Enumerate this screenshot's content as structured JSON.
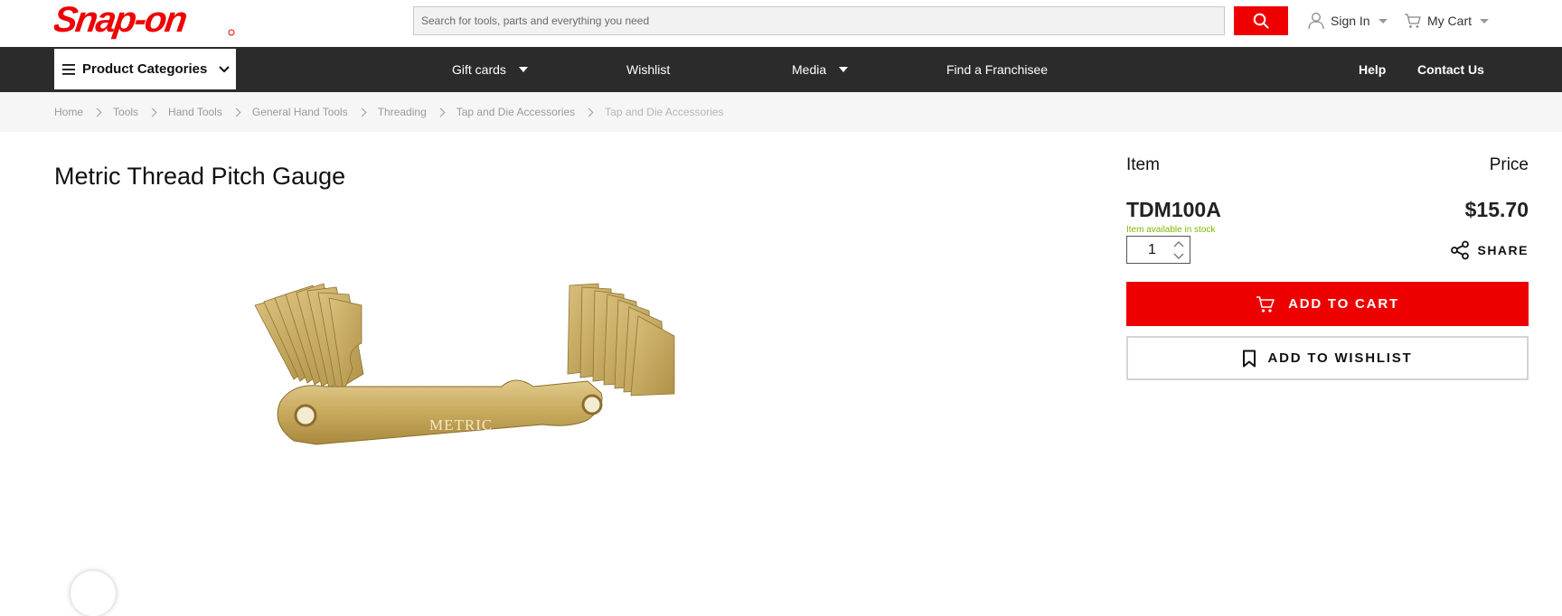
{
  "header": {
    "logo_alt": "Snap-on",
    "search_placeholder": "Search for tools, parts and everything you need",
    "sign_in": "Sign In",
    "cart": "My Cart"
  },
  "nav": {
    "categories": "Product Categories",
    "gift_cards": "Gift cards",
    "wishlist": "Wishlist",
    "media": "Media",
    "franchisee": "Find a Franchisee",
    "help": "Help",
    "contact": "Contact Us"
  },
  "breadcrumb": [
    "Home",
    "Tools",
    "Hand Tools",
    "General Hand Tools",
    "Threading",
    "Tap and Die Accessories",
    "Tap and Die Accessories"
  ],
  "product": {
    "title": "Metric Thread Pitch Gauge",
    "image_stamp": "METRIC",
    "item_label": "Item",
    "price_label": "Price",
    "sku": "TDM100A",
    "price": "$15.70",
    "stock": "Item available in stock",
    "quantity": "1",
    "share": "SHARE",
    "add_to_cart": "ADD TO CART",
    "add_to_wishlist": "ADD TO WISHLIST"
  },
  "colors": {
    "brand_red": "#ee0000",
    "nav_dark": "#2b2b2b",
    "stock_green": "#7fb800"
  }
}
